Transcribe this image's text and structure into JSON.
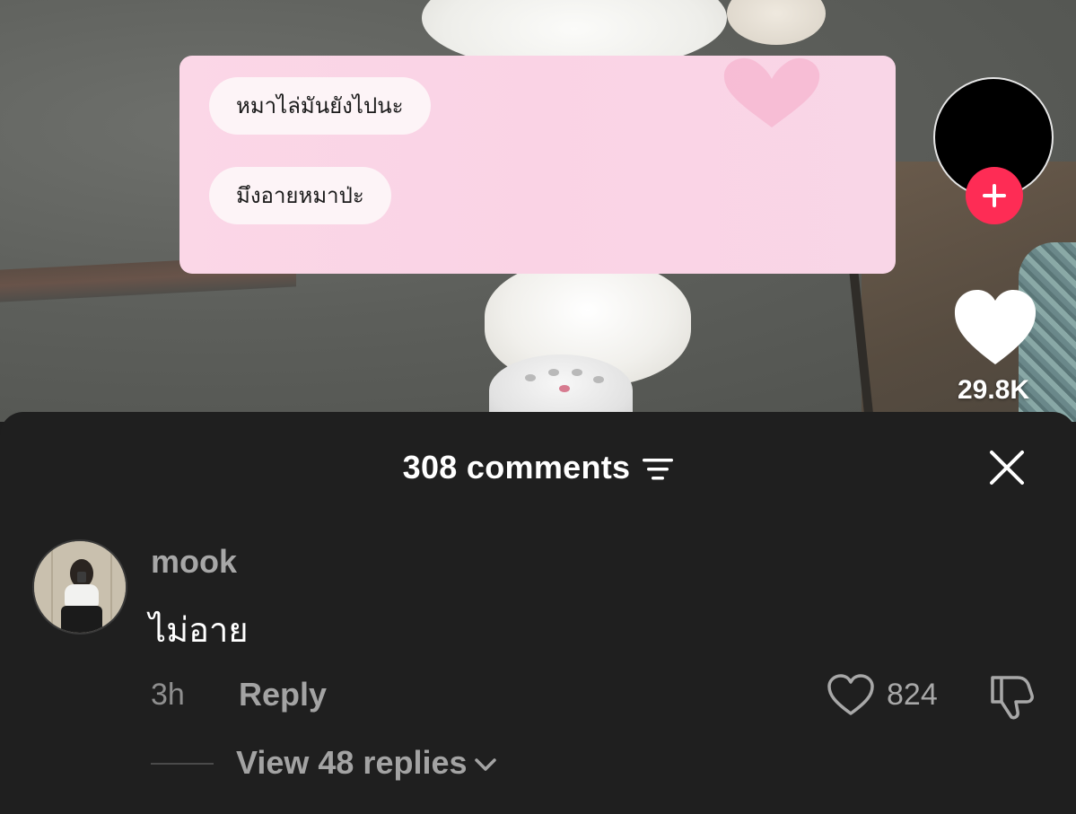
{
  "video": {
    "chat_messages": [
      "หมาไล่มันยังไปนะ",
      "มึงอายหมาป่ะ"
    ]
  },
  "action_rail": {
    "follow_icon": "plus-icon",
    "like_icon": "heart-icon",
    "like_count": "29.8K"
  },
  "comments_sheet": {
    "title": "308 comments",
    "filter_icon": "filter-icon",
    "close_icon": "close-icon",
    "comments": [
      {
        "username": "mook",
        "text": "ไม่อาย",
        "time": "3h",
        "reply_label": "Reply",
        "like_count": "824",
        "view_replies_label": "View 48 replies"
      }
    ]
  },
  "colors": {
    "sheet_background": "#1f1f1f",
    "follow_button": "#fe2c55",
    "chat_card": "#fbd7e7",
    "bubble": "#fdf4f7"
  }
}
